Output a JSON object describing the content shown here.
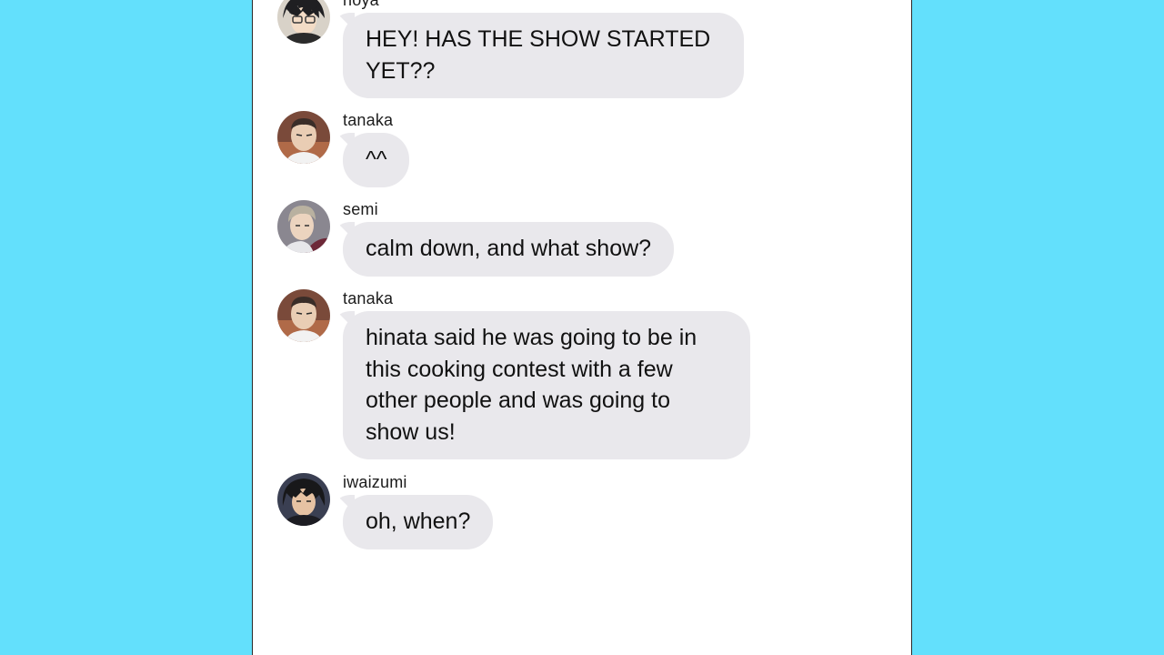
{
  "colors": {
    "page_background": "#63e0fc",
    "panel_background": "#ffffff",
    "bubble_background": "#e9e8ec",
    "text": "#111111"
  },
  "messages": [
    {
      "sender": "noya",
      "text": "HEY! HAS THE SHOW STARTED YET??",
      "avatar_icon": "noya-avatar-icon"
    },
    {
      "sender": "tanaka",
      "text": "^^",
      "avatar_icon": "tanaka-avatar-icon"
    },
    {
      "sender": "semi",
      "text": "calm down, and what show?",
      "avatar_icon": "semi-avatar-icon"
    },
    {
      "sender": "tanaka",
      "text": "hinata said he was going to be in this cooking contest with a few other people and was going to show us!",
      "avatar_icon": "tanaka-avatar-icon"
    },
    {
      "sender": "iwaizumi",
      "text": "oh, when?",
      "avatar_icon": "iwaizumi-avatar-icon"
    }
  ]
}
